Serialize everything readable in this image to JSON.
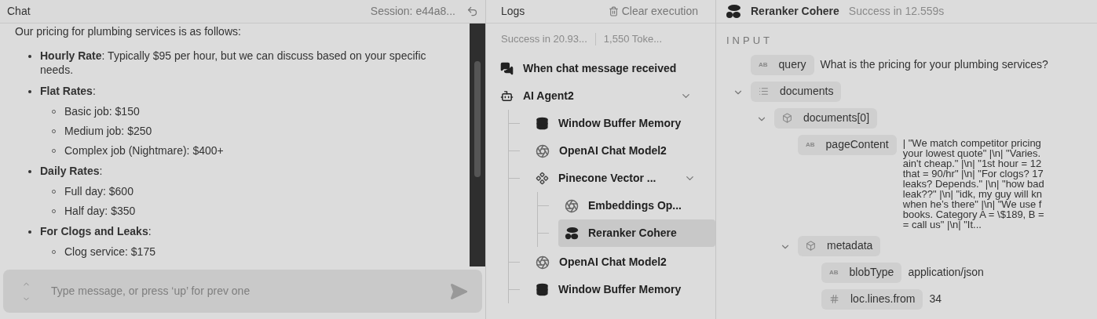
{
  "chat": {
    "title": "Chat",
    "session": "Session: e44a8...",
    "intro": "Our pricing for plumbing services is as follows:",
    "items": [
      {
        "text": "**Hourly Rate**: Typically $95 per hour, but we can discuss based on your specific needs."
      },
      {
        "text": "**Flat Rates**:",
        "children": [
          "Basic job: $150",
          "Medium job: $250",
          "Complex job (Nightmare): $400+"
        ]
      },
      {
        "text": "**Daily Rates**:",
        "children": [
          "Full day: $600",
          "Half day: $350"
        ]
      },
      {
        "text": "**For Clogs and Leaks**:",
        "children": [
          "Clog service: $175"
        ]
      }
    ],
    "input": {
      "placeholder": "Type message, or press ‘up’ for prev one"
    }
  },
  "logs": {
    "title": "Logs",
    "clear_button": "Clear execution",
    "status": "Success in 20.93...",
    "tokens": "1,550 Toke...",
    "tree": [
      {
        "label": "When chat message received",
        "kind": "trigger",
        "selected": false
      },
      {
        "label": "AI Agent2",
        "kind": "agent",
        "selected": false,
        "expanded": true,
        "children": [
          {
            "label": "Window Buffer Memory",
            "kind": "memory",
            "selected": false
          },
          {
            "label": "OpenAI Chat Model2",
            "kind": "model",
            "selected": false
          },
          {
            "label": "Pinecone Vector ...",
            "kind": "vectorstore",
            "selected": false,
            "expanded": true,
            "children": [
              {
                "label": "Embeddings Op...",
                "kind": "model",
                "selected": false
              },
              {
                "label": "Reranker Cohere",
                "kind": "reranker",
                "selected": true
              }
            ]
          },
          {
            "label": "OpenAI Chat Model2",
            "kind": "model",
            "selected": false
          },
          {
            "label": "Window Buffer Memory",
            "kind": "memory",
            "selected": false
          }
        ]
      }
    ]
  },
  "detail": {
    "title": "Reranker Cohere",
    "status": "Success in 12.559s",
    "section": "INPUT",
    "fields": [
      {
        "kind": "string",
        "badge": "AB",
        "key": "query",
        "value": [
          "What is the pricing for your plumbing services?"
        ]
      },
      {
        "kind": "array",
        "key": "documents",
        "expanded": true,
        "children": [
          {
            "kind": "object",
            "key": "documents[0]",
            "expanded": true,
            "children": [
              {
                "kind": "string",
                "badge": "AB",
                "key": "pageContent",
                "value": [
                  "| \"We match competitor pricing",
                  "your lowest quote\" |\\n| \"Varies.",
                  "ain't cheap.\" |\\n| \"1st hour = 12",
                  "that = 90/hr\" |\\n| \"For clogs? 17",
                  "leaks? Depends.\" |\\n| \"how bad",
                  "leak??\" |\\n| \"idk, my guy will kn",
                  "when he’s there\" |\\n| \"We use f",
                  "books. Category A = \\$189, B =",
                  "= call us\" |\\n| \"It..."
                ]
              },
              {
                "kind": "object",
                "key": "metadata",
                "expanded": true,
                "children": [
                  {
                    "kind": "string",
                    "badge": "AB",
                    "key": "blobType",
                    "value": [
                      "application/json"
                    ]
                  },
                  {
                    "kind": "number",
                    "key": "loc.lines.from",
                    "value": [
                      "34"
                    ]
                  }
                ]
              }
            ]
          }
        ]
      }
    ]
  }
}
